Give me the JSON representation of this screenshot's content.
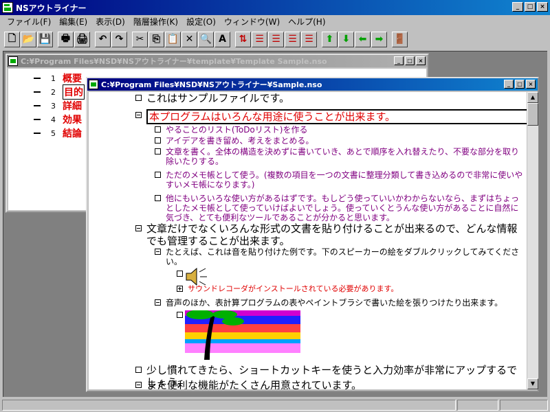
{
  "app": {
    "title": "NSアウトライナー"
  },
  "menu": [
    "ファイル(F)",
    "編集(E)",
    "表示(D)",
    "階層操作(K)",
    "設定(O)",
    "ウィンドウ(W)",
    "ヘルプ(H)"
  ],
  "window_buttons": {
    "minimize": "_",
    "maximize": "□",
    "close": "×"
  },
  "toolbar": [
    {
      "name": "new-document",
      "glyph": "🗋",
      "color": "#000000"
    },
    {
      "name": "open-folder",
      "glyph": "📂",
      "color": "#b08000"
    },
    {
      "name": "save",
      "glyph": "💾",
      "color": "#000080"
    },
    {
      "sep": true
    },
    {
      "name": "print",
      "glyph": "🖶",
      "color": "#000000"
    },
    {
      "name": "print-preview",
      "glyph": "🖨",
      "color": "#000000"
    },
    {
      "sep": true
    },
    {
      "name": "undo",
      "glyph": "↶",
      "color": "#000000"
    },
    {
      "name": "redo",
      "glyph": "↷",
      "color": "#000000"
    },
    {
      "sep": true
    },
    {
      "name": "cut",
      "glyph": "✂",
      "color": "#000000"
    },
    {
      "name": "copy",
      "glyph": "⎘",
      "color": "#000000"
    },
    {
      "name": "paste",
      "glyph": "📋",
      "color": "#806000"
    },
    {
      "name": "delete",
      "glyph": "✕",
      "color": "#000000"
    },
    {
      "name": "find",
      "glyph": "🔍",
      "color": "#000000"
    },
    {
      "name": "font",
      "glyph": "A",
      "color": "#000000"
    },
    {
      "sep": true
    },
    {
      "name": "sort-1",
      "glyph": "⇅",
      "color": "#c00000"
    },
    {
      "name": "sort-2",
      "glyph": "☰",
      "color": "#c00000"
    },
    {
      "name": "sort-3",
      "glyph": "☰",
      "color": "#c00000"
    },
    {
      "name": "sort-4",
      "glyph": "☰",
      "color": "#c00000"
    },
    {
      "name": "sort-5",
      "glyph": "☰",
      "color": "#c00000"
    },
    {
      "sep": true
    },
    {
      "name": "move-up",
      "glyph": "⬆",
      "color": "#00a000"
    },
    {
      "name": "move-down",
      "glyph": "⬇",
      "color": "#00a000"
    },
    {
      "name": "move-left",
      "glyph": "⬅",
      "color": "#00a000"
    },
    {
      "name": "move-right",
      "glyph": "➡",
      "color": "#00a000"
    },
    {
      "sep": true
    },
    {
      "name": "exit",
      "glyph": "🚪",
      "color": "#a000a0"
    }
  ],
  "template_window": {
    "title": "C:¥Program Files¥NSD¥NSアウトライナー¥template¥Template Sample.nso",
    "rows": [
      {
        "num": "1",
        "label": "概要"
      },
      {
        "num": "2",
        "label": "目的"
      },
      {
        "num": "3",
        "label": "詳細"
      },
      {
        "num": "4",
        "label": "効果"
      },
      {
        "num": "5",
        "label": "結論"
      }
    ]
  },
  "sample_window": {
    "title": "C:¥Program Files¥NSD¥NSアウトライナー¥Sample.nso",
    "nodes": [
      {
        "level": 1,
        "icon": "leaf",
        "color": "#000000",
        "text": "これはサンプルファイルです。"
      },
      {
        "level": 1,
        "icon": "minus",
        "color": "#e00000",
        "text": "本プログラムはいろんな用途に使うことが出来ます。"
      },
      {
        "level": 2,
        "icon": "leaf",
        "color": "#800080",
        "text": "やることのリスト(ToDoリスト)を作る"
      },
      {
        "level": 2,
        "icon": "leaf",
        "color": "#800080",
        "text": "アイデアを書き留め、考えをまとめる。"
      },
      {
        "level": 2,
        "icon": "leaf",
        "color": "#800080",
        "text": "文章を書く。全体の構造を決めずに書いていき、あとで順序を入れ替えたり、不要な部分を取り除いたりする。"
      },
      {
        "level": 2,
        "icon": "leaf",
        "color": "#800080",
        "text": "ただのメモ帳として使う。(複数の項目を一つの文書に整理分類して書き込めるので非常に使いやすいメモ帳になります。)"
      },
      {
        "level": 2,
        "icon": "leaf",
        "color": "#800080",
        "text": "他にもいろいろな使い方があるはずです。もしどう使っていいかわからないなら、まずはちょっとしたメモ帳として使っていけばよいでしょう。使っていくとうんな使い方があることに自然に気づき、とても便利なツールであることが分かると思います。"
      },
      {
        "level": 1,
        "icon": "minus",
        "color": "#000000",
        "text": "文章だけでなくいろんな形式の文書を貼り付けることが出来るので、どんな情報でも管理することが出来ます。"
      },
      {
        "level": 2,
        "icon": "minus",
        "color": "#000000",
        "text": "たとえば、これは音を貼り付けた例です。下のスピーカーの絵をダブルクリックしてみてください。"
      },
      {
        "level": 3,
        "icon": "leaf",
        "color": "#000000",
        "text": ""
      },
      {
        "level": 3,
        "icon": "plus",
        "color": "#e00000",
        "text": "サウンドレコーダがインストールされている必要があります。"
      },
      {
        "level": 2,
        "icon": "minus",
        "color": "#000000",
        "text": "音声のほか、表計算プログラムの表やペイントブラシで書いた絵を張りつけたり出来ます。"
      },
      {
        "level": 3,
        "icon": "leaf",
        "color": "#000000",
        "text": ""
      },
      {
        "level": 1,
        "icon": "leaf",
        "color": "#000000",
        "text": "少し慣れてきたら、ショートカットキーを使うと入力効率が非常にアップするでしょう。"
      },
      {
        "level": 1,
        "icon": "minus",
        "color": "#000000",
        "text": "また便利な機能がたくさん用意されています。"
      }
    ]
  }
}
